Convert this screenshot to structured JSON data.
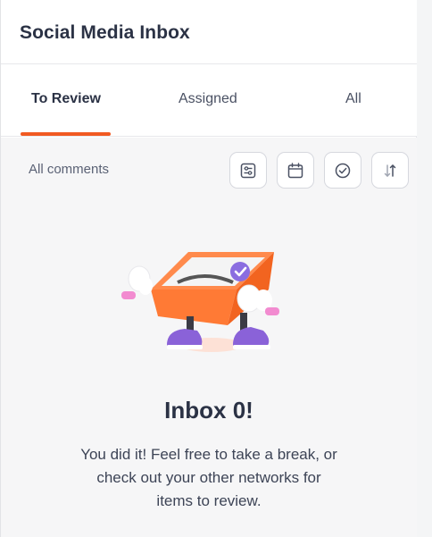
{
  "header": {
    "title": "Social Media Inbox"
  },
  "tabs": [
    {
      "label": "To Review",
      "active": true
    },
    {
      "label": "Assigned",
      "active": false
    },
    {
      "label": "All",
      "active": false
    }
  ],
  "filter": {
    "label": "All comments"
  },
  "toolbar": {
    "icons": [
      "filter-sliders-icon",
      "calendar-icon",
      "check-circle-icon",
      "sort-icon"
    ]
  },
  "empty_state": {
    "title": "Inbox 0!",
    "message_line1": "You did it! Feel free to take a break, or",
    "message_line2": "check out your other networks for",
    "message_line3": "items to review."
  },
  "colors": {
    "accent": "#f15a22",
    "title": "#2b3245",
    "background": "#f6f6f7"
  }
}
